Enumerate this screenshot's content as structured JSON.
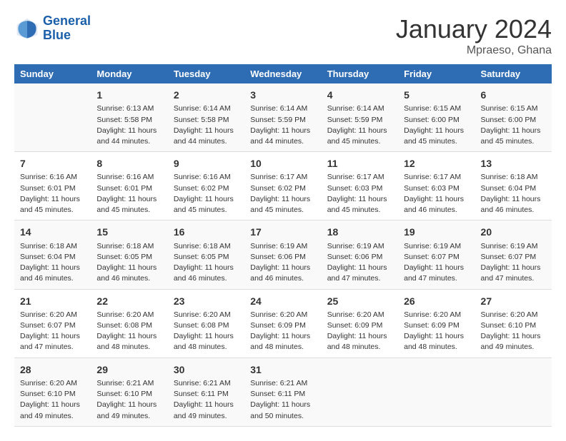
{
  "header": {
    "logo_line1": "General",
    "logo_line2": "Blue",
    "month": "January 2024",
    "location": "Mpraeso, Ghana"
  },
  "weekdays": [
    "Sunday",
    "Monday",
    "Tuesday",
    "Wednesday",
    "Thursday",
    "Friday",
    "Saturday"
  ],
  "weeks": [
    [
      {
        "day": "",
        "sunrise": "",
        "sunset": "",
        "daylight": ""
      },
      {
        "day": "1",
        "sunrise": "Sunrise: 6:13 AM",
        "sunset": "Sunset: 5:58 PM",
        "daylight": "Daylight: 11 hours and 44 minutes."
      },
      {
        "day": "2",
        "sunrise": "Sunrise: 6:14 AM",
        "sunset": "Sunset: 5:58 PM",
        "daylight": "Daylight: 11 hours and 44 minutes."
      },
      {
        "day": "3",
        "sunrise": "Sunrise: 6:14 AM",
        "sunset": "Sunset: 5:59 PM",
        "daylight": "Daylight: 11 hours and 44 minutes."
      },
      {
        "day": "4",
        "sunrise": "Sunrise: 6:14 AM",
        "sunset": "Sunset: 5:59 PM",
        "daylight": "Daylight: 11 hours and 45 minutes."
      },
      {
        "day": "5",
        "sunrise": "Sunrise: 6:15 AM",
        "sunset": "Sunset: 6:00 PM",
        "daylight": "Daylight: 11 hours and 45 minutes."
      },
      {
        "day": "6",
        "sunrise": "Sunrise: 6:15 AM",
        "sunset": "Sunset: 6:00 PM",
        "daylight": "Daylight: 11 hours and 45 minutes."
      }
    ],
    [
      {
        "day": "7",
        "sunrise": "Sunrise: 6:16 AM",
        "sunset": "Sunset: 6:01 PM",
        "daylight": "Daylight: 11 hours and 45 minutes."
      },
      {
        "day": "8",
        "sunrise": "Sunrise: 6:16 AM",
        "sunset": "Sunset: 6:01 PM",
        "daylight": "Daylight: 11 hours and 45 minutes."
      },
      {
        "day": "9",
        "sunrise": "Sunrise: 6:16 AM",
        "sunset": "Sunset: 6:02 PM",
        "daylight": "Daylight: 11 hours and 45 minutes."
      },
      {
        "day": "10",
        "sunrise": "Sunrise: 6:17 AM",
        "sunset": "Sunset: 6:02 PM",
        "daylight": "Daylight: 11 hours and 45 minutes."
      },
      {
        "day": "11",
        "sunrise": "Sunrise: 6:17 AM",
        "sunset": "Sunset: 6:03 PM",
        "daylight": "Daylight: 11 hours and 45 minutes."
      },
      {
        "day": "12",
        "sunrise": "Sunrise: 6:17 AM",
        "sunset": "Sunset: 6:03 PM",
        "daylight": "Daylight: 11 hours and 46 minutes."
      },
      {
        "day": "13",
        "sunrise": "Sunrise: 6:18 AM",
        "sunset": "Sunset: 6:04 PM",
        "daylight": "Daylight: 11 hours and 46 minutes."
      }
    ],
    [
      {
        "day": "14",
        "sunrise": "Sunrise: 6:18 AM",
        "sunset": "Sunset: 6:04 PM",
        "daylight": "Daylight: 11 hours and 46 minutes."
      },
      {
        "day": "15",
        "sunrise": "Sunrise: 6:18 AM",
        "sunset": "Sunset: 6:05 PM",
        "daylight": "Daylight: 11 hours and 46 minutes."
      },
      {
        "day": "16",
        "sunrise": "Sunrise: 6:18 AM",
        "sunset": "Sunset: 6:05 PM",
        "daylight": "Daylight: 11 hours and 46 minutes."
      },
      {
        "day": "17",
        "sunrise": "Sunrise: 6:19 AM",
        "sunset": "Sunset: 6:06 PM",
        "daylight": "Daylight: 11 hours and 46 minutes."
      },
      {
        "day": "18",
        "sunrise": "Sunrise: 6:19 AM",
        "sunset": "Sunset: 6:06 PM",
        "daylight": "Daylight: 11 hours and 47 minutes."
      },
      {
        "day": "19",
        "sunrise": "Sunrise: 6:19 AM",
        "sunset": "Sunset: 6:07 PM",
        "daylight": "Daylight: 11 hours and 47 minutes."
      },
      {
        "day": "20",
        "sunrise": "Sunrise: 6:19 AM",
        "sunset": "Sunset: 6:07 PM",
        "daylight": "Daylight: 11 hours and 47 minutes."
      }
    ],
    [
      {
        "day": "21",
        "sunrise": "Sunrise: 6:20 AM",
        "sunset": "Sunset: 6:07 PM",
        "daylight": "Daylight: 11 hours and 47 minutes."
      },
      {
        "day": "22",
        "sunrise": "Sunrise: 6:20 AM",
        "sunset": "Sunset: 6:08 PM",
        "daylight": "Daylight: 11 hours and 48 minutes."
      },
      {
        "day": "23",
        "sunrise": "Sunrise: 6:20 AM",
        "sunset": "Sunset: 6:08 PM",
        "daylight": "Daylight: 11 hours and 48 minutes."
      },
      {
        "day": "24",
        "sunrise": "Sunrise: 6:20 AM",
        "sunset": "Sunset: 6:09 PM",
        "daylight": "Daylight: 11 hours and 48 minutes."
      },
      {
        "day": "25",
        "sunrise": "Sunrise: 6:20 AM",
        "sunset": "Sunset: 6:09 PM",
        "daylight": "Daylight: 11 hours and 48 minutes."
      },
      {
        "day": "26",
        "sunrise": "Sunrise: 6:20 AM",
        "sunset": "Sunset: 6:09 PM",
        "daylight": "Daylight: 11 hours and 48 minutes."
      },
      {
        "day": "27",
        "sunrise": "Sunrise: 6:20 AM",
        "sunset": "Sunset: 6:10 PM",
        "daylight": "Daylight: 11 hours and 49 minutes."
      }
    ],
    [
      {
        "day": "28",
        "sunrise": "Sunrise: 6:20 AM",
        "sunset": "Sunset: 6:10 PM",
        "daylight": "Daylight: 11 hours and 49 minutes."
      },
      {
        "day": "29",
        "sunrise": "Sunrise: 6:21 AM",
        "sunset": "Sunset: 6:10 PM",
        "daylight": "Daylight: 11 hours and 49 minutes."
      },
      {
        "day": "30",
        "sunrise": "Sunrise: 6:21 AM",
        "sunset": "Sunset: 6:11 PM",
        "daylight": "Daylight: 11 hours and 49 minutes."
      },
      {
        "day": "31",
        "sunrise": "Sunrise: 6:21 AM",
        "sunset": "Sunset: 6:11 PM",
        "daylight": "Daylight: 11 hours and 50 minutes."
      },
      {
        "day": "",
        "sunrise": "",
        "sunset": "",
        "daylight": ""
      },
      {
        "day": "",
        "sunrise": "",
        "sunset": "",
        "daylight": ""
      },
      {
        "day": "",
        "sunrise": "",
        "sunset": "",
        "daylight": ""
      }
    ]
  ]
}
